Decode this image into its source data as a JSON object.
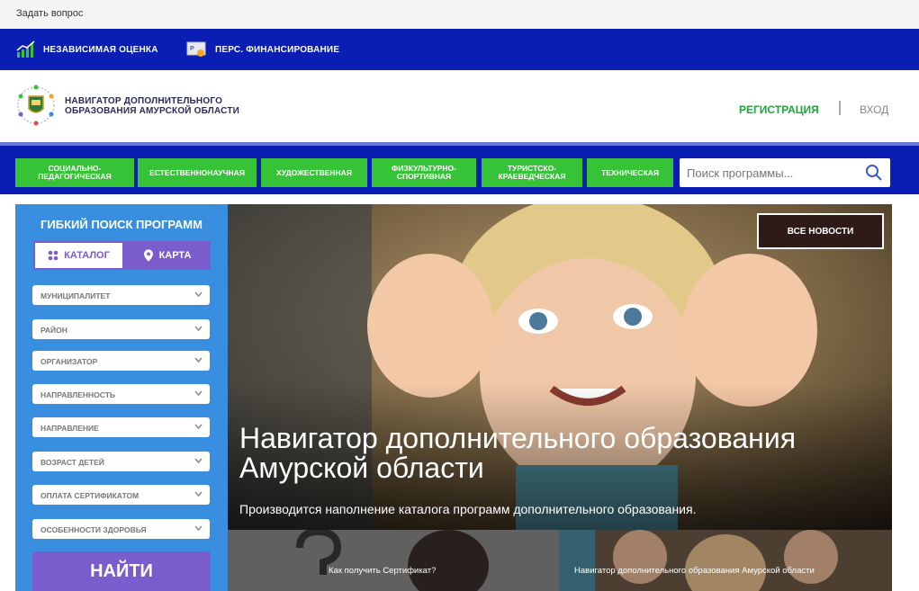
{
  "topbar": {
    "ask_label": "Задать вопрос"
  },
  "bluebar": {
    "items": [
      {
        "label": "НЕЗАВИСИМАЯ ОЦЕНКА"
      },
      {
        "label": "ПЕРС. ФИНАНСИРОВАНИЕ"
      }
    ]
  },
  "header": {
    "title_line1": "НАВИГАТОР ДОПОЛНИТЕЛЬНОГО",
    "title_line2": "ОБРАЗОВАНИЯ АМУРСКОЙ ОБЛАСТИ",
    "register_label": "РЕГИСТРАЦИЯ",
    "login_label": "ВХОД"
  },
  "categories": [
    {
      "line1": "СОЦИАЛЬНО-",
      "line2": "ПЕДАГОГИЧЕСКАЯ"
    },
    {
      "line1": "ЕСТЕСТВЕННОНАУЧНАЯ",
      "line2": ""
    },
    {
      "line1": "ХУДОЖЕСТВЕННАЯ",
      "line2": ""
    },
    {
      "line1": "ФИЗКУЛЬТУРНО-",
      "line2": "СПОРТИВНАЯ"
    },
    {
      "line1": "ТУРИСТСКО-",
      "line2": "КРАЕВЕДЧЕСКАЯ"
    },
    {
      "line1": "ТЕХНИЧЕСКАЯ",
      "line2": ""
    }
  ],
  "search": {
    "placeholder": "Поиск программы..."
  },
  "sidebar": {
    "title": "ГИБКИЙ ПОИСК ПРОГРАММ",
    "catalog_label": "КАТАЛОГ",
    "map_label": "КАРТА",
    "filters": [
      "МУНИЦИПАЛИТЕТ",
      "РАЙОН",
      "ОРГАНИЗАТОР",
      "НАПРАВЛЕННОСТЬ",
      "НАПРАВЛЕНИЕ",
      "ВОЗРАСТ ДЕТЕЙ",
      "ОПЛАТА СЕРТИФИКАТОМ",
      "ОСОБЕННОСТИ ЗДОРОВЬЯ"
    ],
    "find_label": "НАЙТИ"
  },
  "hero": {
    "all_news_label": "ВСЕ НОВОСТИ",
    "title_line1": "Навигатор дополнительного образования",
    "title_line2": "Амурской области",
    "subtitle": "Производится наполнение каталога программ дополнительного образования."
  },
  "thumbs": [
    {
      "caption": "Как получить Сертификат?"
    },
    {
      "caption": "Навигатор дополнительного образования Амурской области"
    }
  ],
  "colors": {
    "nav_blue": "#0a1eb4",
    "green": "#37c337",
    "sidebar_blue": "#3a8ee0",
    "purple": "#7a5ccc",
    "register_green": "#1fa43c"
  }
}
